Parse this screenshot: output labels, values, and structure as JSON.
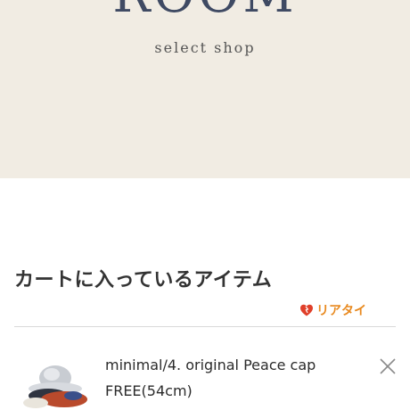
{
  "header": {
    "logo_text": "ROOM",
    "tagline": "select shop"
  },
  "cart": {
    "title": "カートに入っているアイテム",
    "badge_label": "リアタイ",
    "items": [
      {
        "name": "minimal/4. original Peace cap",
        "variant": "FREE(54cm)"
      }
    ]
  },
  "icons": {
    "badge_icon": "heart-icon",
    "remove_icon": "close-icon"
  },
  "colors": {
    "hero_background": "#f1ece3",
    "logo": "#3f4a63",
    "badge": "#e8891e",
    "heart": "#e0402a"
  }
}
